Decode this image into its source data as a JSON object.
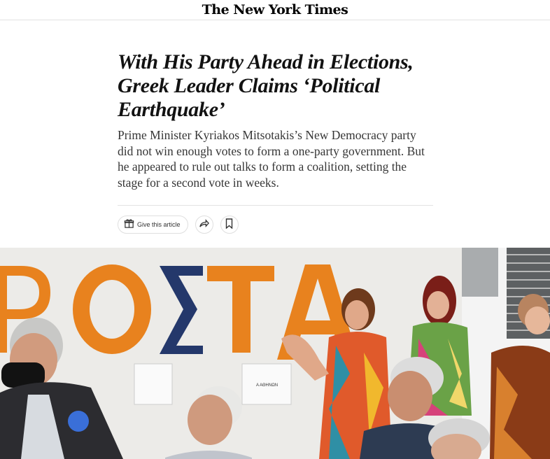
{
  "masthead": {
    "logo": "The New York Times"
  },
  "article": {
    "headline": "With His Party Ahead in Elections, Greek Leader Claims ‘Political Earthquake’",
    "summary": "Prime Minister Kyriakos Mitsotakis’s New Democracy party did not win enough votes to form a one-party government. But he appeared to rule out talks to form a coalition, setting the stage for a second vote in weeks."
  },
  "actions": {
    "gift_label": "Give this article",
    "gift_icon": "gift-icon",
    "share_icon": "share-icon",
    "save_icon": "bookmark-icon"
  },
  "photo": {
    "wall_text": "ΡΟΣΤΑ",
    "colors": {
      "orange": "#e8821e",
      "navy": "#24386b",
      "wall": "#eeeeec"
    }
  }
}
